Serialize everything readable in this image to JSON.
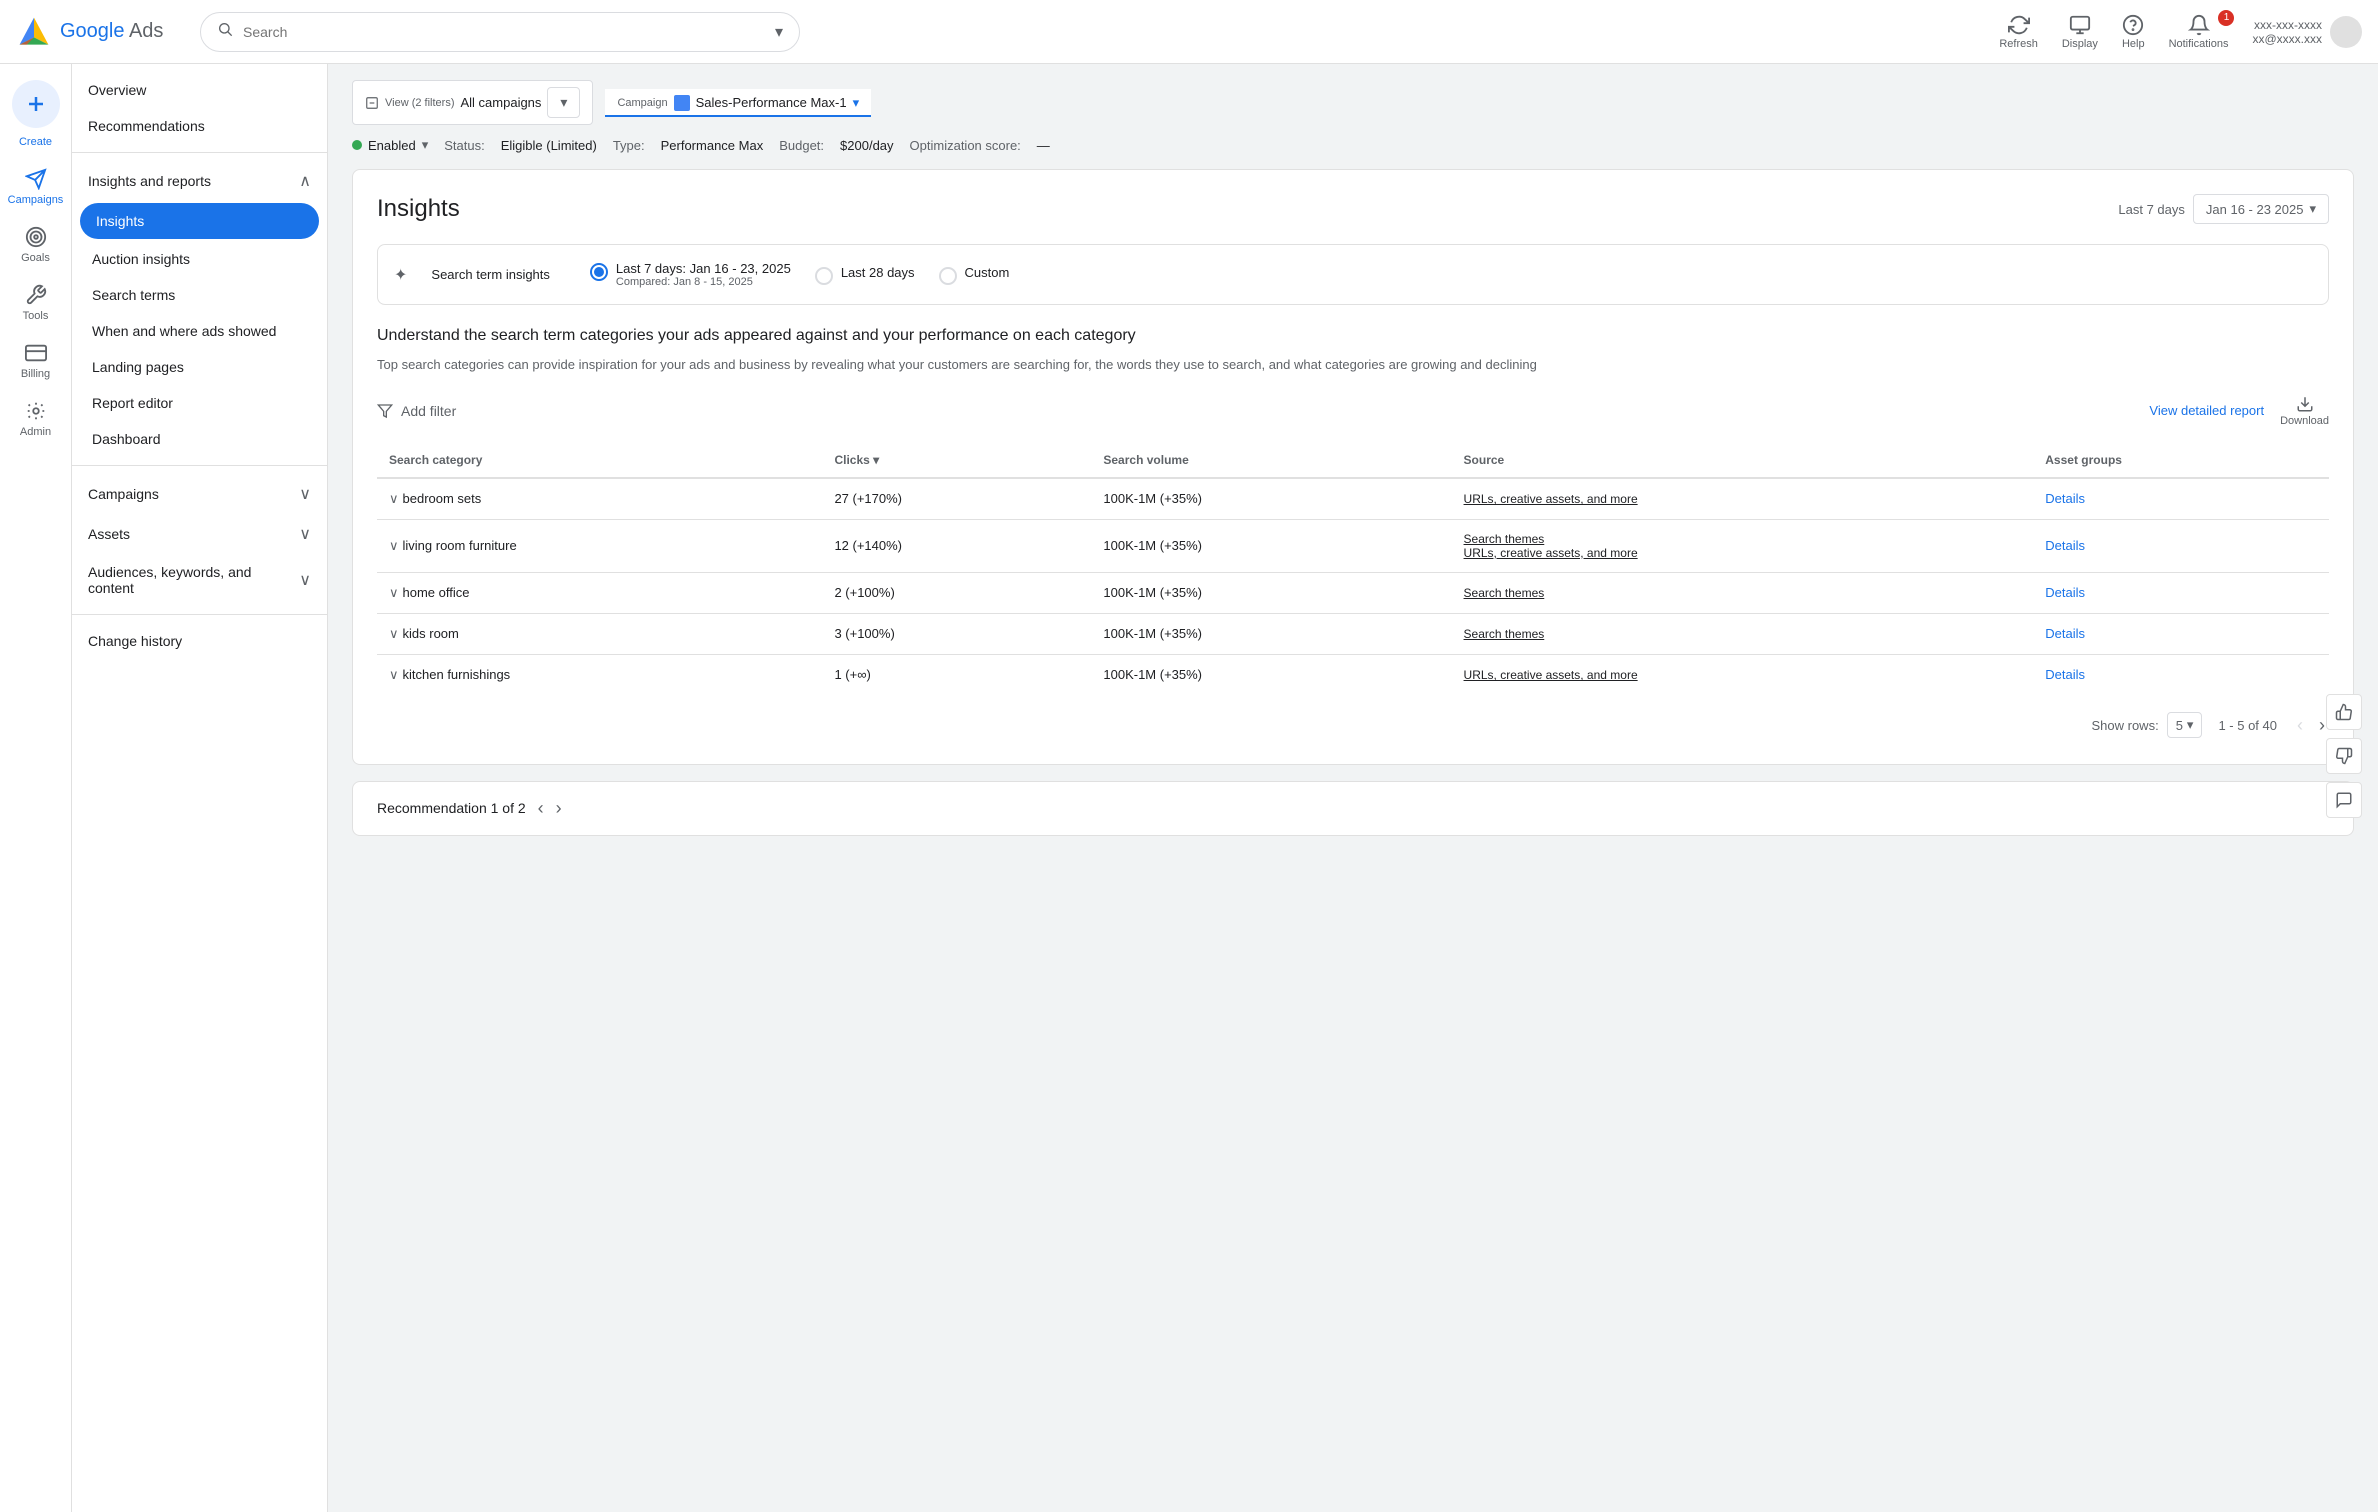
{
  "topNav": {
    "logoText": "Google Ads",
    "searchPlaceholder": "Search",
    "actions": [
      {
        "id": "refresh",
        "label": "Refresh",
        "icon": "↻"
      },
      {
        "id": "display",
        "label": "Display",
        "icon": "▦"
      },
      {
        "id": "help",
        "label": "Help",
        "icon": "?"
      },
      {
        "id": "notifications",
        "label": "Notifications",
        "icon": "🔔",
        "badge": "1"
      }
    ],
    "userEmail": "xx@xxxx.xxx",
    "userId": "xxx-xxx-xxxx"
  },
  "iconNav": [
    {
      "id": "create",
      "label": "Create",
      "icon": "+"
    },
    {
      "id": "campaigns",
      "label": "Campaigns",
      "icon": "📢",
      "active": true
    },
    {
      "id": "goals",
      "label": "Goals",
      "icon": "🏆"
    },
    {
      "id": "tools",
      "label": "Tools",
      "icon": "🔧"
    },
    {
      "id": "billing",
      "label": "Billing",
      "icon": "💳"
    },
    {
      "id": "admin",
      "label": "Admin",
      "icon": "⚙"
    }
  ],
  "sidebar": {
    "items": [
      {
        "id": "overview",
        "label": "Overview",
        "type": "top"
      },
      {
        "id": "recommendations",
        "label": "Recommendations",
        "type": "top"
      },
      {
        "id": "insights-reports",
        "label": "Insights and reports",
        "type": "section",
        "expanded": true
      },
      {
        "id": "insights",
        "label": "Insights",
        "type": "sub",
        "active": true
      },
      {
        "id": "auction-insights",
        "label": "Auction insights",
        "type": "sub"
      },
      {
        "id": "search-terms",
        "label": "Search terms",
        "type": "sub"
      },
      {
        "id": "when-where",
        "label": "When and where ads showed",
        "type": "sub"
      },
      {
        "id": "landing-pages",
        "label": "Landing pages",
        "type": "sub"
      },
      {
        "id": "report-editor",
        "label": "Report editor",
        "type": "sub"
      },
      {
        "id": "dashboard",
        "label": "Dashboard",
        "type": "sub"
      },
      {
        "id": "campaigns",
        "label": "Campaigns",
        "type": "section",
        "expanded": false
      },
      {
        "id": "assets",
        "label": "Assets",
        "type": "section",
        "expanded": false
      },
      {
        "id": "audiences",
        "label": "Audiences, keywords, and content",
        "type": "section",
        "expanded": false
      },
      {
        "id": "change-history",
        "label": "Change history",
        "type": "top"
      }
    ]
  },
  "campaignHeader": {
    "filterLabel": "View (2 filters)",
    "filterValue": "All campaigns",
    "campaignLabel": "Campaign",
    "campaignValue": "Sales-Performance Max-1"
  },
  "statusBar": {
    "status": "Enabled",
    "statusDetail": "Eligible (Limited)",
    "type": "Performance Max",
    "budget": "$200/day",
    "optimizationScore": "—"
  },
  "insightsPage": {
    "title": "Insights",
    "lastPeriodLabel": "Last 7 days",
    "dateRange": "Jan 16 - 23 2025",
    "dateRangeChevron": "▾",
    "radioOptions": [
      {
        "id": "last7",
        "label": "Last 7 days: Jan 16 - 23, 2025",
        "sub": "Compared: Jan 8 - 15, 2025",
        "checked": true
      },
      {
        "id": "last28",
        "label": "Last 28 days",
        "checked": false
      },
      {
        "id": "custom",
        "label": "Custom",
        "checked": false
      }
    ],
    "sparkLabel": "Search term insights",
    "descTitle": "Understand the search term categories your ads appeared against and your performance on each category",
    "descText": "Top search categories can provide inspiration for your ads and business by revealing what your customers are searching for, the words they use to search, and what categories are growing and declining",
    "addFilterLabel": "Add filter",
    "viewReportLabel": "View detailed report",
    "downloadLabel": "Download",
    "table": {
      "columns": [
        {
          "id": "category",
          "label": "Search category"
        },
        {
          "id": "clicks",
          "label": "Clicks ▾",
          "sortable": true
        },
        {
          "id": "volume",
          "label": "Search volume"
        },
        {
          "id": "source",
          "label": "Source"
        },
        {
          "id": "assetgroups",
          "label": "Asset groups"
        }
      ],
      "rows": [
        {
          "category": "bedroom sets",
          "clicks": "27 (+170%)",
          "volume": "100K-1M (+35%)",
          "source": [
            "URLs, creative assets, and more"
          ],
          "assetGroups": "Details"
        },
        {
          "category": "living room furniture",
          "clicks": "12 (+140%)",
          "volume": "100K-1M (+35%)",
          "source": [
            "Search themes",
            "URLs, creative assets, and more"
          ],
          "assetGroups": "Details"
        },
        {
          "category": "home office",
          "clicks": "2 (+100%)",
          "volume": "100K-1M (+35%)",
          "source": [
            "Search themes"
          ],
          "assetGroups": "Details"
        },
        {
          "category": "kids room",
          "clicks": "3 (+100%)",
          "volume": "100K-1M (+35%)",
          "source": [
            "Search themes"
          ],
          "assetGroups": "Details"
        },
        {
          "category": "kitchen furnishings",
          "clicks": "1 (+∞)",
          "volume": "100K-1M (+35%)",
          "source": [
            "URLs, creative assets, and more"
          ],
          "assetGroups": "Details"
        }
      ]
    },
    "pagination": {
      "showRowsLabel": "Show rows:",
      "rowsValue": "5",
      "pageInfo": "1 - 5 of 40"
    },
    "recommendation": {
      "label": "Recommendation 1 of 2"
    }
  }
}
